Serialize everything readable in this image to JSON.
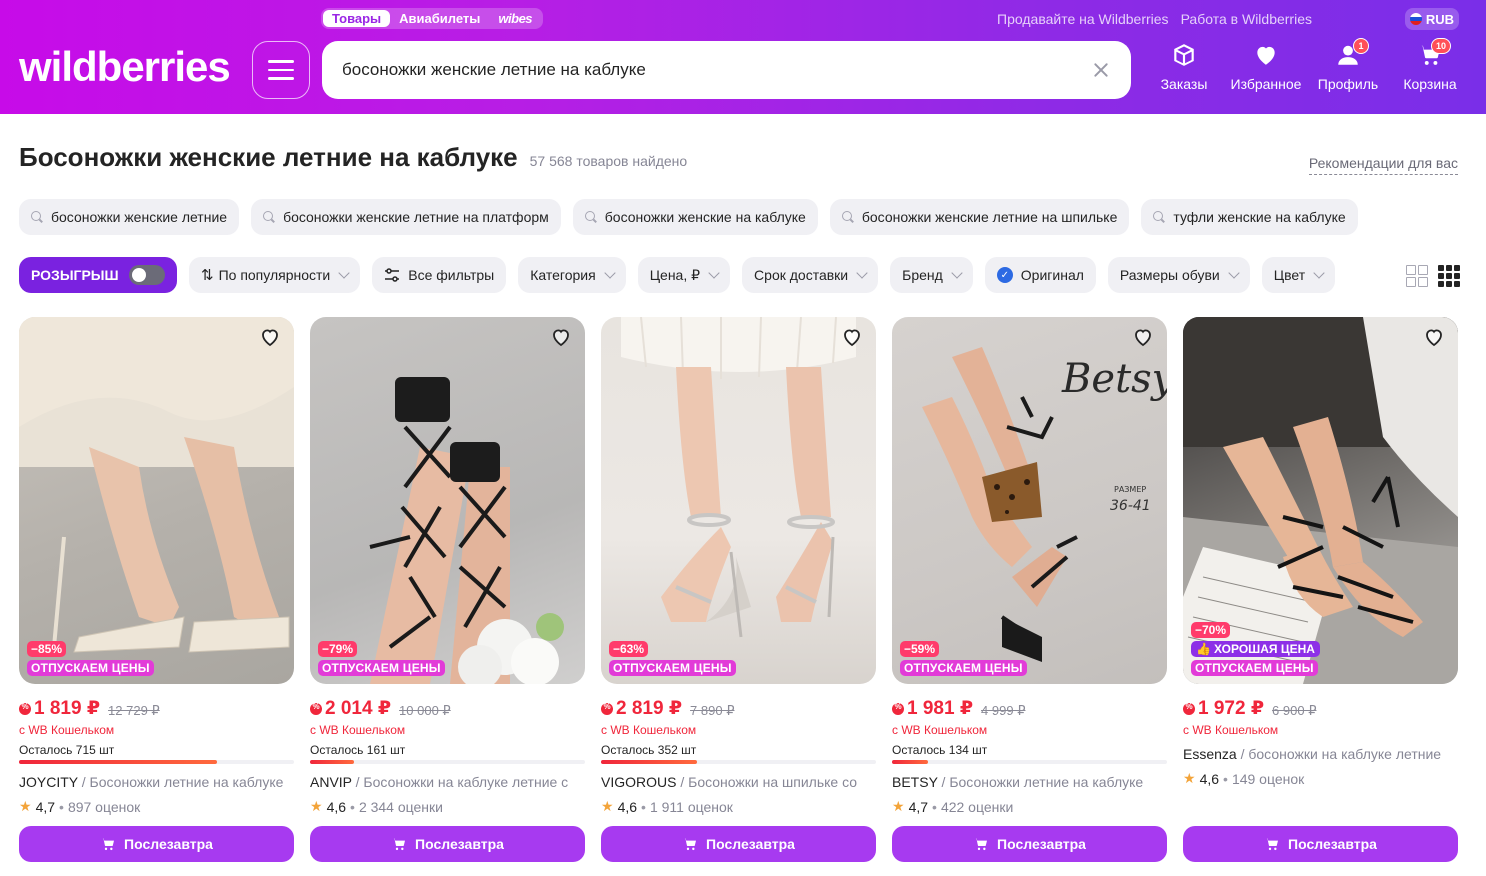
{
  "header": {
    "tabs": [
      {
        "label": "Товары",
        "active": true
      },
      {
        "label": "Авиабилеты",
        "active": false
      },
      {
        "label": "wibes",
        "active": false
      }
    ],
    "links": [
      "Продавайте на Wildberries",
      "Работа в Wildberries"
    ],
    "currency": "RUB",
    "logo": "wildberries",
    "search_value": "босоножки женские летние на каблуке",
    "nav": [
      {
        "label": "Заказы",
        "icon": "box-icon",
        "badge": ""
      },
      {
        "label": "Избранное",
        "icon": "heart-icon",
        "badge": ""
      },
      {
        "label": "Профиль",
        "icon": "user-icon",
        "badge": "1"
      },
      {
        "label": "Корзина",
        "icon": "cart-icon",
        "badge": "10"
      }
    ]
  },
  "page": {
    "title": "Босоножки женские летние на каблуке",
    "count": "57 568 товаров найдено",
    "recommendations": "Рекомендации для вас"
  },
  "suggestions": [
    "босоножки женские летние",
    "босоножки женские летние на платформ",
    "босоножки женские на каблуке",
    "босоножки женские летние на шпильке",
    "туфли женские на каблуке"
  ],
  "filters": {
    "raffle": "РОЗЫГРЫШ",
    "sort": "По популярности",
    "all": "Все фильтры",
    "items": [
      "Категория",
      "Цена, ₽",
      "Срок доставки",
      "Бренд"
    ],
    "original": "Оригинал",
    "items2": [
      "Размеры обуви",
      "Цвет"
    ]
  },
  "colors": {
    "accent": "#a73af0",
    "price": "#f0263b",
    "promo": "#e23bd8"
  },
  "products": [
    {
      "discount": "−85%",
      "promo": "ОТПУСКАЕМ ЦЕНЫ",
      "good_price": "",
      "price": "1 819 ₽",
      "old_price": "12 729 ₽",
      "wallet": "с WB Кошельком",
      "left": "Осталось 715 шт",
      "stock_level": 0.72,
      "brand": "JOYCITY",
      "desc": " / Босоножки летние на каблуке",
      "rating": "4,7",
      "reviews": "897 оценок",
      "button": "Послезавтра"
    },
    {
      "discount": "−79%",
      "promo": "ОТПУСКАЕМ ЦЕНЫ",
      "good_price": "",
      "price": "2 014 ₽",
      "old_price": "10 000 ₽",
      "wallet": "с WB Кошельком",
      "left": "Осталось 161 шт",
      "stock_level": 0.16,
      "brand": "ANVIP",
      "desc": " / Босоножки на каблуке летние с",
      "rating": "4,6",
      "reviews": "2 344 оценки",
      "button": "Послезавтра"
    },
    {
      "discount": "−63%",
      "promo": "ОТПУСКАЕМ ЦЕНЫ",
      "good_price": "",
      "price": "2 819 ₽",
      "old_price": "7 890 ₽",
      "wallet": "с WB Кошельком",
      "left": "Осталось 352 шт",
      "stock_level": 0.35,
      "brand": "VIGOROUS",
      "desc": " / Босоножки на шпильке со",
      "rating": "4,6",
      "reviews": "1 911 оценок",
      "button": "Послезавтра"
    },
    {
      "discount": "−59%",
      "promo": "ОТПУСКАЕМ ЦЕНЫ",
      "good_price": "",
      "price": "1 981 ₽",
      "old_price": "4 999 ₽",
      "wallet": "с WB Кошельком",
      "left": "Осталось 134 шт",
      "stock_level": 0.13,
      "brand": "BETSY",
      "desc": " / Босоножки летние на каблуке",
      "rating": "4,7",
      "reviews": "422 оценки",
      "button": "Послезавтра"
    },
    {
      "discount": "−70%",
      "promo": "ОТПУСКАЕМ ЦЕНЫ",
      "good_price": "ХОРОШАЯ ЦЕНА",
      "price": "1 972 ₽",
      "old_price": "6 900 ₽",
      "wallet": "с WB Кошельком",
      "left": "",
      "stock_level": null,
      "brand": "Essenza",
      "desc": " / босоножки на каблуке летние",
      "rating": "4,6",
      "reviews": "149 оценок",
      "button": "Послезавтра"
    }
  ]
}
